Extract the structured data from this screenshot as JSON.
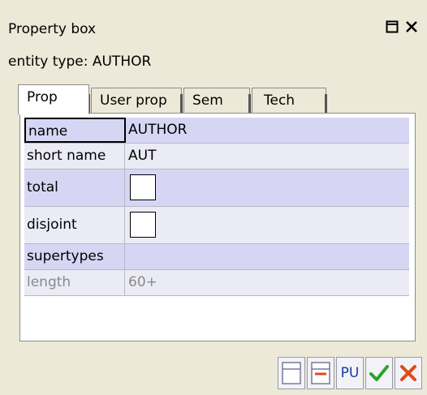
{
  "window": {
    "title": "Property box",
    "subtitle": "entity type: AUTHOR"
  },
  "tabs": [
    "Prop",
    "User prop",
    "Sem",
    "Tech"
  ],
  "rows": [
    {
      "key": "name",
      "value": "AUTHOR"
    },
    {
      "key": "short name",
      "value": "AUT"
    },
    {
      "key": "total",
      "value": ""
    },
    {
      "key": "disjoint",
      "value": ""
    },
    {
      "key": "supertypes",
      "value": ""
    },
    {
      "key": "length",
      "value": "60+"
    }
  ],
  "checkboxes": {
    "total": false,
    "disjoint": false
  },
  "toolbar": {
    "pu_label": "PU"
  },
  "icons": [
    "restore-icon",
    "close-icon",
    "panel-icon",
    "remove-row-icon",
    "check-icon",
    "cancel-icon"
  ],
  "colors": {
    "row_highlight": "#d6d6f4",
    "row_light": "#ebebf6",
    "ok": "#2aa32a",
    "cancel": "#e04a1a"
  }
}
